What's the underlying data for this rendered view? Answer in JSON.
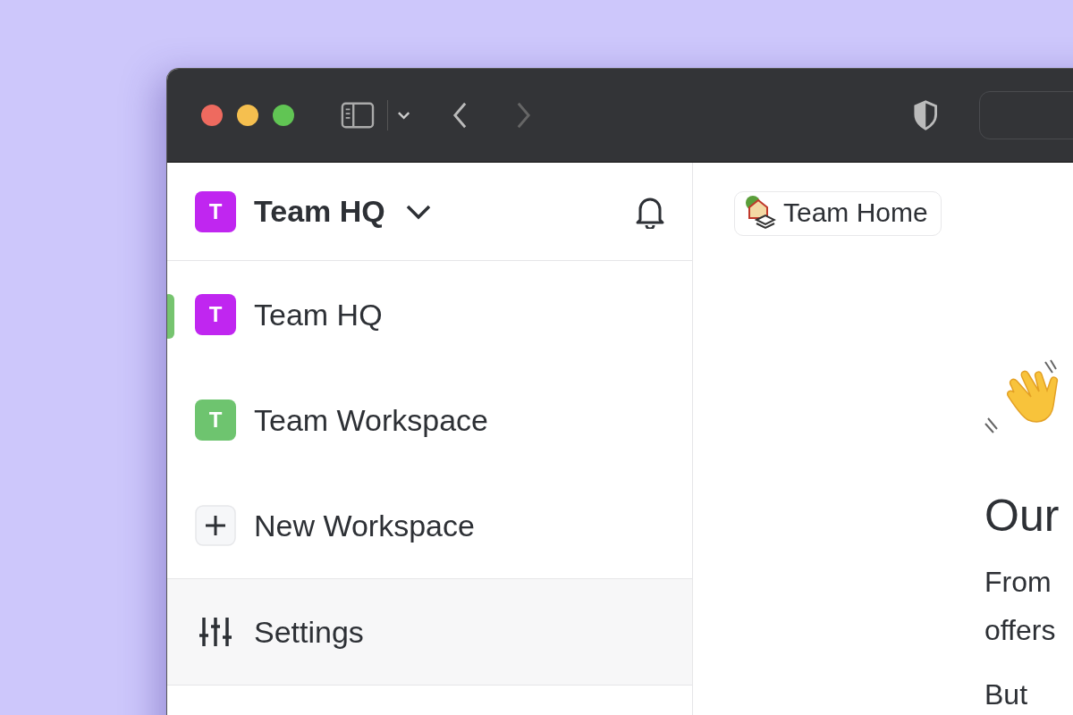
{
  "workspace_switcher": {
    "name": "Team HQ",
    "initial": "T",
    "color": "#c026f0"
  },
  "workspaces": [
    {
      "kind": "workspace",
      "name": "Team HQ",
      "initial": "T",
      "color": "#c026f0",
      "selected": true
    },
    {
      "kind": "workspace",
      "name": "Team Workspace",
      "initial": "T",
      "color": "#6ec46f",
      "selected": false
    },
    {
      "kind": "add",
      "name": "New Workspace",
      "selected": false
    }
  ],
  "settings": {
    "label": "Settings"
  },
  "page": {
    "breadcrumb": "Team Home",
    "heading": "Our",
    "paragraphs": [
      [
        "From",
        "offers"
      ],
      [
        "But"
      ]
    ]
  }
}
